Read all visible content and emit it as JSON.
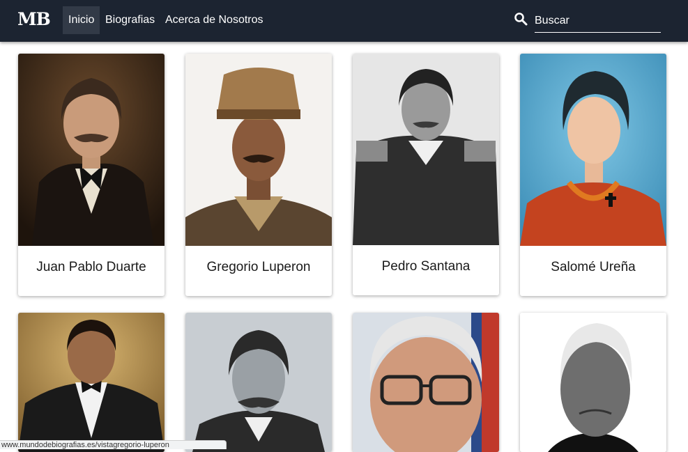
{
  "navbar": {
    "brand": "MB",
    "items": [
      {
        "label": "Inicio",
        "active": true
      },
      {
        "label": "Biografias",
        "active": false
      },
      {
        "label": "Acerca de Nosotros",
        "active": false
      }
    ],
    "search_placeholder": "Buscar",
    "search_icon": "search-icon"
  },
  "cards": [
    {
      "name": "Juan Pablo Duarte"
    },
    {
      "name": "Gregorio Luperon"
    },
    {
      "name": "Pedro Santana"
    },
    {
      "name": "Salomé Ureña"
    },
    {
      "name": ""
    },
    {
      "name": ""
    },
    {
      "name": ""
    },
    {
      "name": ""
    }
  ],
  "status_bar": {
    "url": "www.mundodebiografias.es/vistagregorio-luperon"
  },
  "colors": {
    "navbar_bg": "#1c2431",
    "active_item_bg": "#323a47"
  }
}
